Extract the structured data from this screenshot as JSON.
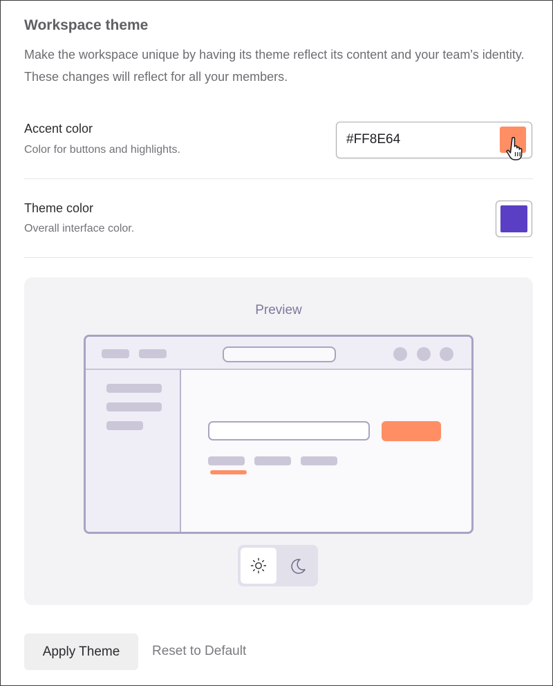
{
  "section": {
    "title": "Workspace theme",
    "description": "Make the workspace unique by having its theme reflect its content and your team's identity. These changes will reflect for all your members."
  },
  "accent": {
    "label": "Accent color",
    "description": "Color for buttons and highlights.",
    "value": "#FF8E64",
    "swatch_color": "#FF8E64"
  },
  "theme": {
    "label": "Theme color",
    "description": "Overall interface color.",
    "swatch_color": "#5A3FC4"
  },
  "preview": {
    "label": "Preview",
    "mode_options": [
      {
        "name": "light",
        "icon": "sun-icon",
        "selected": true
      },
      {
        "name": "dark",
        "icon": "moon-icon",
        "selected": false
      }
    ]
  },
  "actions": {
    "apply_label": "Apply Theme",
    "reset_label": "Reset to Default"
  },
  "colors": {
    "accent": "#FF8E64",
    "theme": "#5A3FC4"
  }
}
